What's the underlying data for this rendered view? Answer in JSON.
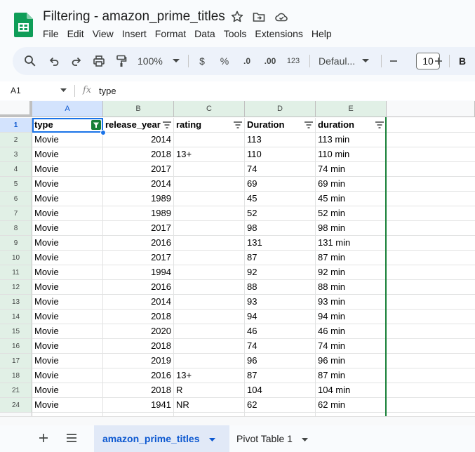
{
  "app": {
    "doc_title": "Filtering - amazon_prime_titles"
  },
  "menu": [
    "File",
    "Edit",
    "View",
    "Insert",
    "Format",
    "Data",
    "Tools",
    "Extensions",
    "Help"
  ],
  "toolbar": {
    "zoom": "100%",
    "currency": "$",
    "percent": "%",
    "dec_decrease": ".0",
    "dec_increase": ".00",
    "number_format": "123",
    "font": "Defaul...",
    "font_size": "10",
    "bold": "B"
  },
  "formula_bar": {
    "cell_ref": "A1",
    "fx": "fx",
    "content": "type"
  },
  "columns": [
    "A",
    "B",
    "C",
    "D",
    "E"
  ],
  "header_row": {
    "row_num": "1",
    "cells": [
      "type",
      "release_year",
      "rating",
      "Duration",
      "duration"
    ]
  },
  "rows": [
    {
      "row_num": "2",
      "cells": [
        "Movie",
        "2014",
        "",
        "113",
        "113 min"
      ]
    },
    {
      "row_num": "3",
      "cells": [
        "Movie",
        "2018",
        "13+",
        "110",
        "110 min"
      ]
    },
    {
      "row_num": "4",
      "cells": [
        "Movie",
        "2017",
        "",
        "74",
        "74 min"
      ]
    },
    {
      "row_num": "5",
      "cells": [
        "Movie",
        "2014",
        "",
        "69",
        "69 min"
      ]
    },
    {
      "row_num": "6",
      "cells": [
        "Movie",
        "1989",
        "",
        "45",
        "45 min"
      ]
    },
    {
      "row_num": "7",
      "cells": [
        "Movie",
        "1989",
        "",
        "52",
        "52 min"
      ]
    },
    {
      "row_num": "8",
      "cells": [
        "Movie",
        "2017",
        "",
        "98",
        "98 min"
      ]
    },
    {
      "row_num": "9",
      "cells": [
        "Movie",
        "2016",
        "",
        "131",
        "131 min"
      ]
    },
    {
      "row_num": "10",
      "cells": [
        "Movie",
        "2017",
        "",
        "87",
        "87 min"
      ]
    },
    {
      "row_num": "11",
      "cells": [
        "Movie",
        "1994",
        "",
        "92",
        "92 min"
      ]
    },
    {
      "row_num": "12",
      "cells": [
        "Movie",
        "2016",
        "",
        "88",
        "88 min"
      ]
    },
    {
      "row_num": "13",
      "cells": [
        "Movie",
        "2014",
        "",
        "93",
        "93 min"
      ]
    },
    {
      "row_num": "14",
      "cells": [
        "Movie",
        "2018",
        "",
        "94",
        "94 min"
      ]
    },
    {
      "row_num": "15",
      "cells": [
        "Movie",
        "2020",
        "",
        "46",
        "46 min"
      ]
    },
    {
      "row_num": "16",
      "cells": [
        "Movie",
        "2018",
        "",
        "74",
        "74 min"
      ]
    },
    {
      "row_num": "17",
      "cells": [
        "Movie",
        "2019",
        "",
        "96",
        "96 min"
      ]
    },
    {
      "row_num": "18",
      "cells": [
        "Movie",
        "2016",
        "13+",
        "87",
        "87 min"
      ]
    },
    {
      "row_num": "21",
      "cells": [
        "Movie",
        "2018",
        "R",
        "104",
        "104 min"
      ]
    },
    {
      "row_num": "24",
      "cells": [
        "Movie",
        "1941",
        "NR",
        "62",
        "62 min"
      ]
    }
  ],
  "sheets": [
    {
      "name": "amazon_prime_titles",
      "active": true
    },
    {
      "name": "Pivot Table 1",
      "active": false
    }
  ],
  "colors": {
    "filter_active": "#188038",
    "selection": "#1a73e8",
    "tab_active_text": "#0b57d0"
  }
}
